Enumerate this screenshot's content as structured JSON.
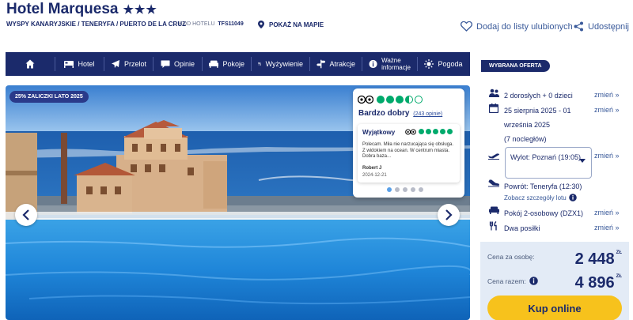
{
  "header": {
    "title": "Hotel Marquesa",
    "stars": "★★★",
    "breadcrumb": "WYSPY KANARYJSKIE / TENERYFA / PUERTO DE LA CRUZ",
    "code_label": "KOD HOTELU",
    "code_value": "TFS11049",
    "map_label": "POKAŻ NA MAPIE",
    "favorite_label": "Dodaj do listy ulubionych",
    "share_label": "Udostępnij"
  },
  "nav": {
    "home_icon": "home-icon",
    "items": [
      {
        "label": "Hotel",
        "icon": "bed-icon"
      },
      {
        "label": "Przelot",
        "icon": "plane-icon"
      },
      {
        "label": "Opinie",
        "icon": "chat-icon"
      },
      {
        "label": "Pokoje",
        "icon": "sofa-icon"
      },
      {
        "label": "Wyżywienie",
        "icon": "cutlery-icon"
      },
      {
        "label": "Atrakcje",
        "icon": "signpost-icon"
      },
      {
        "label": "Ważne informacje",
        "icon": "info-icon"
      },
      {
        "label": "Pogoda",
        "icon": "sun-icon"
      }
    ]
  },
  "gallery": {
    "promo_badge": "25% ZALICZKI LATO 2025"
  },
  "review": {
    "rating_dots": 3.5,
    "title": "Bardzo dobry",
    "count_link": "(243 opinie)",
    "item": {
      "title": "Wyjątkowy",
      "rating_dots": 5,
      "text": "Polecam. Miła nie narzucająca się obsługa. Z widokiem na ocean. W centrum miasta. Dobra baza...",
      "author": "Robert J",
      "date": "2024-12-21"
    },
    "pager_count": 5,
    "pager_active": 0
  },
  "offer": {
    "header": "WYBRANA OFERTA",
    "change_label": "zmień",
    "guests": "2 dorosłych + 0 dzieci",
    "dates": "25 sierpnia 2025 - 01 września 2025",
    "nights": "(7 nocległów)",
    "departure": "Wylot: Poznań (19:05)",
    "return": "Powrót: Teneryfa (12:30)",
    "flight_details": "Zobacz szczegóły lotu",
    "room": "Pokój 2-osobowy (DZX1)",
    "board": "Dwa posiłki",
    "price_per_person_label": "Cena za osobę:",
    "price_per_person": "2 448",
    "price_total_label": "Cena razem:",
    "price_total": "4 896",
    "currency": "ZŁ",
    "buy_label": "Kup online"
  },
  "colors": {
    "navy": "#1b2a6b",
    "accent_yellow": "#f7c21c",
    "tripadvisor_green": "#00aa6c",
    "price_bg": "#e3ebf6"
  }
}
